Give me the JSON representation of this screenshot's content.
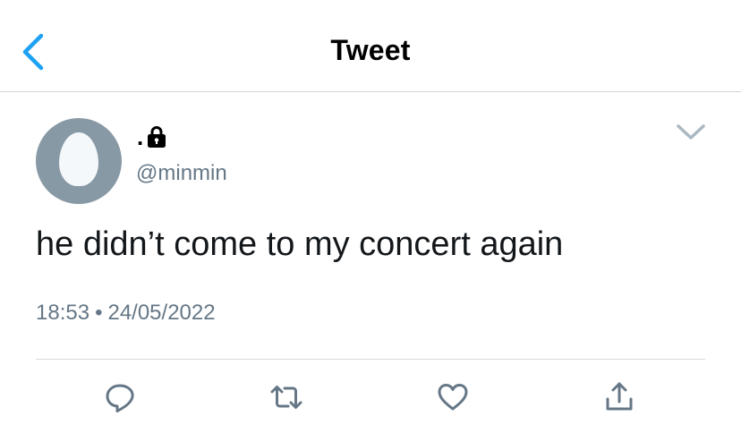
{
  "nav": {
    "title": "Tweet",
    "back_icon": "chevron-left-icon"
  },
  "author": {
    "display_name": ".",
    "protected_icon": "lock-icon",
    "handle": "@minmin",
    "avatar": "default-egg-avatar"
  },
  "tweet": {
    "text": "he didn’t come to my concert again",
    "time": "18:53",
    "separator": "•",
    "date": "24/05/2022"
  },
  "actions": [
    {
      "name": "reply",
      "icon": "comment-icon"
    },
    {
      "name": "retweet",
      "icon": "retweet-icon"
    },
    {
      "name": "like",
      "icon": "heart-icon"
    },
    {
      "name": "share",
      "icon": "share-icon"
    }
  ],
  "colors": {
    "accent": "#1da1f2",
    "text_primary": "#14171a",
    "text_secondary": "#657786",
    "divider": "#cfd4d9",
    "avatar_bg": "#8899a6"
  }
}
